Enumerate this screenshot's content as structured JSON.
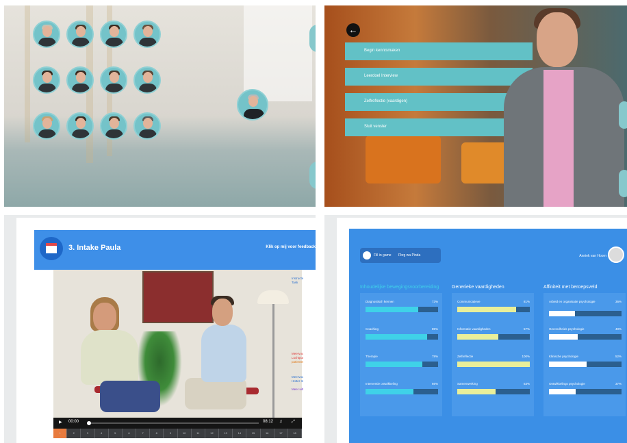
{
  "colors": {
    "teal": "#62c1c6",
    "blue": "#3b8fe6",
    "cyan_fill": "#3fd2e8",
    "yellow_fill": "#e9ef9a",
    "white_fill": "#ffffff",
    "track": "#2b5f8f"
  },
  "persona_grid": {
    "rows": 3,
    "cols": 4
  },
  "menu": {
    "back_icon": "arrow-left-icon",
    "items": [
      {
        "label": "Begin kennismaken"
      },
      {
        "label": "Leerdoel Interview"
      },
      {
        "label": "Zelfreflectie (vaardigen)"
      },
      {
        "label": "Sluit venster"
      }
    ]
  },
  "video_app": {
    "title": "3. Intake Paula",
    "link": "Klik op mij voor feedback",
    "current_time": "00:00",
    "duration": "08:12",
    "icons": {
      "calendar": "calendar-icon",
      "play": "play-icon",
      "volume": "volume-icon",
      "fullscreen": "fullscreen-icon"
    },
    "chapters": [
      "1",
      "2",
      "3",
      "4",
      "5",
      "6",
      "7",
      "8",
      "9",
      "10",
      "11",
      "12",
      "13",
      "14",
      "15",
      "16",
      "17",
      "18"
    ],
    "active_chapter": 1,
    "side_notes": [
      {
        "text": "Instructie Jo",
        "color": "#2a6fcf"
      },
      {
        "text": "Task",
        "color": "#2a6fcf"
      },
      {
        "text": "Meervoudend",
        "color": "#e03a3a"
      },
      {
        "text": "Luchtpunt",
        "color": "#e03a3a"
      },
      {
        "text": "patienten",
        "color": "#e07a1a"
      },
      {
        "text": "Meervoudend",
        "color": "#2a6fcf"
      },
      {
        "text": "Hotter Inch",
        "color": "#2a6fcf"
      },
      {
        "text": "Meer uitlev",
        "color": "#7a3ad0"
      }
    ]
  },
  "dashboard": {
    "pill_label": "Fill in game",
    "pill_secondary": "Fbrg wa Pinda",
    "user_name": "Anniek van Hoorn",
    "user_avatar_icon": "user-avatar-icon",
    "columns": [
      {
        "title": "Inhoudelijke bewegingsvoorbereiding",
        "title_color": "#3fd2e8",
        "fill": "#3fd2e8",
        "skills": [
          {
            "label": "Diagnostisch kennen",
            "value": 73
          },
          {
            "label": "Coaching",
            "value": 85
          },
          {
            "label": "Therapie",
            "value": 78
          },
          {
            "label": "Interventie ontwikkeling",
            "value": 66
          }
        ]
      },
      {
        "title": "Generieke vaardigheden",
        "title_color": "#ffffff",
        "fill": "#e9ef9a",
        "skills": [
          {
            "label": "Communicatieve",
            "value": 81
          },
          {
            "label": "Informatie vaardigheden",
            "value": 57
          },
          {
            "label": "Zelfreflectie",
            "value": 100
          },
          {
            "label": "Samenwerking",
            "value": 53
          }
        ]
      },
      {
        "title": "Affiniteit met beroepsveld",
        "title_color": "#ffffff",
        "fill": "#ffffff",
        "skills": [
          {
            "label": "Arbeid en organisatie psychologie",
            "value": 36
          },
          {
            "label": "Gezondheids psychologie",
            "value": 40
          },
          {
            "label": "Klinische psychologie",
            "value": 52
          },
          {
            "label": "Ontwikkelings psychologie",
            "value": 37
          }
        ]
      }
    ]
  }
}
